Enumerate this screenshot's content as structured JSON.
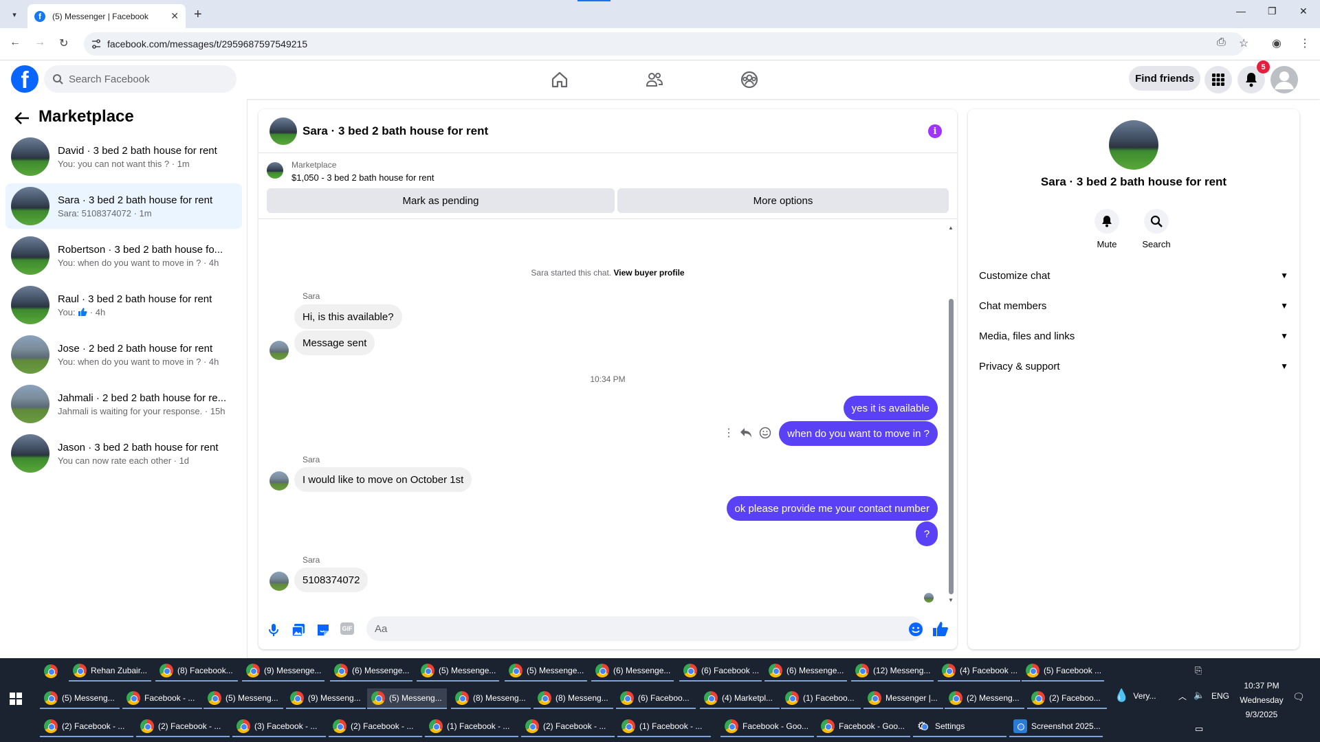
{
  "browser": {
    "tab_title": "(5) Messenger | Facebook",
    "url": "facebook.com/messages/t/2959687597549215"
  },
  "fb": {
    "search_placeholder": "Search Facebook",
    "find_friends": "Find friends",
    "notif_count": "5"
  },
  "left": {
    "title": "Marketplace",
    "conversations": [
      {
        "name": "David · 3 bed 2 bath house for rent",
        "preview": "You: you can not want this ? · 1m"
      },
      {
        "name": "Sara · 3 bed 2 bath house for rent",
        "preview": "Sara: 5108374072 · 1m"
      },
      {
        "name": "Robertson · 3 bed 2 bath house fo...",
        "preview": "You: when do you want to move in ? · 4h"
      },
      {
        "name": "Raul · 3 bed 2 bath house for rent",
        "preview": "You: ",
        "preview_tail": " · 4h"
      },
      {
        "name": "Jose · 2 bed 2 bath house for rent",
        "preview": "You: when do you want to move in ? · 4h"
      },
      {
        "name": "Jahmali · 2 bed 2 bath house for re...",
        "preview": "Jahmali is waiting for your response. · 15h"
      },
      {
        "name": "Jason · 3 bed 2 bath house for rent",
        "preview": "You can now rate each other · 1d"
      }
    ]
  },
  "chat": {
    "title": "Sara · 3 bed 2 bath house for rent",
    "marketplace_label": "Marketplace",
    "listing": "$1,050 - 3 bed 2 bath house for rent",
    "mark_pending": "Mark as pending",
    "more_options": "More options",
    "started": "Sara started this chat. ",
    "view_profile": "View buyer profile",
    "sender": "Sara",
    "time": "10:34 PM",
    "messages": {
      "m1": "Hi, is this available?",
      "m2": "Message sent",
      "m3": "yes it is available",
      "m4": "when do you want to move in ?",
      "m5": "I would like to move on October 1st",
      "m6": "ok please provide me your contact number",
      "m7": "?",
      "m8": "5108374072"
    },
    "composer_placeholder": "Aa"
  },
  "right": {
    "name": "Sara · 3 bed 2 bath house for rent",
    "mute": "Mute",
    "search": "Search",
    "rows": [
      "Customize chat",
      "Chat members",
      "Media, files and links",
      "Privacy & support"
    ]
  },
  "taskbar": {
    "row1": [
      "Rehan Zubair...",
      "(8) Facebook...",
      "(9) Messenge...",
      "(6) Messenge...",
      "(5) Messenge...",
      "(5) Messenge...",
      "(6) Messenge...",
      "(6) Facebook ...",
      "(6) Messenge...",
      "(12) Messeng...",
      "(4) Facebook ...",
      "(5) Facebook ..."
    ],
    "row2": [
      "(5) Messeng...",
      "Facebook - ...",
      "(5) Messeng...",
      "(9) Messeng...",
      "(5) Messeng...",
      "(8) Messeng...",
      "(8) Messeng...",
      "(6) Faceboo...",
      "(4) Marketpl...",
      "(1) Faceboo...",
      "Messenger |...",
      "(2) Messeng...",
      "(2) Faceboo..."
    ],
    "row3": [
      "(2) Facebook - ...",
      "(2) Facebook - ...",
      "(3) Facebook - ...",
      "(2) Facebook - ...",
      "(1) Facebook - ...",
      "(2) Facebook - ...",
      "(1) Facebook - ...",
      "Facebook - Goo...",
      "Facebook - Goo...",
      "Settings",
      "Screenshot 2025..."
    ],
    "weather": "Very...",
    "lang": "ENG",
    "time": "10:37 PM",
    "day": "Wednesday",
    "date": "9/3/2025"
  }
}
